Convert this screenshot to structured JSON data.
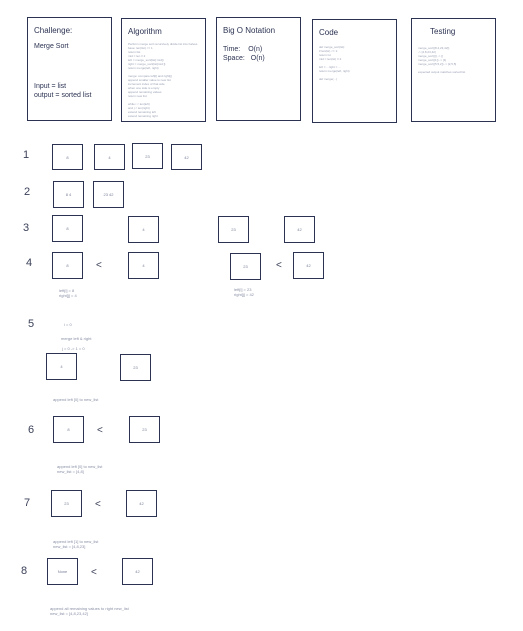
{
  "cards": [
    {
      "title": "Challenge:",
      "line1": "Merge Sort",
      "line2": "Input = list",
      "line3": "output = sorted list"
    },
    {
      "title": "Algorithm",
      "lines": [
        "Perform merge sort recursively divide list into halves",
        "  base: len(list) <= 1",
        "  return list",
        "  mid = len // 2",
        "  left = merge_sort(list[:mid])",
        "  right = merge_sort(list[mid:])",
        "  return merge(left, right)",
        "",
        "merge: compare left[i] and right[j]",
        "  append smaller value to new list",
        "  increment index of that side",
        "  when one side is empty",
        "    append remaining values",
        "  return new list",
        "",
        "  while i < len(left)",
        "    and j < len(right)",
        "  extend remaining left",
        "  extend remaining right"
      ]
    },
    {
      "title": "Big O Notation",
      "time_label": "Time:",
      "time_value": "O(n)",
      "space_label": "Space:",
      "space_value": "O(n)"
    },
    {
      "title": "Code",
      "lines": [
        "def merge_sort(lst):",
        "  if len(lst) <= 1:",
        "    return lst",
        "  mid = len(lst) // 2",
        "",
        "  left = ...right = ...",
        "  return merge(left, right)",
        "",
        "def merge(...)"
      ]
    },
    {
      "title": "Testing",
      "lines": [
        "merge_sort([8,4,23,42])",
        "  -> [4,8,23,42]",
        "merge_sort([]) -> []",
        "merge_sort([1]) -> [1]",
        "merge_sort([5,5,2]) -> [2,5,5]",
        "",
        "expected output matches sorted list"
      ]
    }
  ],
  "steps": [
    "1",
    "2",
    "3",
    "4",
    "5",
    "6",
    "7",
    "8"
  ],
  "row1": [
    "8",
    "4",
    "23",
    "42"
  ],
  "row2": [
    "8 4",
    "23 42"
  ],
  "row3": [
    "8",
    "4",
    "23",
    "42"
  ],
  "row4": [
    "8",
    "4",
    "23",
    "42"
  ],
  "row4_notes": {
    "left": "left[i] = 8\nright[j] = 4",
    "right": "left[i] = 23\nright[j] = 42"
  },
  "lt": "<",
  "row5_notes": {
    "a": "i = 0",
    "b": "merge left & right",
    "c": "j = 0 -> 1 = 0"
  },
  "row5": [
    "4",
    "23"
  ],
  "row5_caption": "append left [0] to new_list",
  "row6": [
    "8",
    "23"
  ],
  "row6_caption": "append left [0] to new_list\nnew_list = [4,8]",
  "row7": [
    "23",
    "42"
  ],
  "row7_caption": "append left [1] to new_list\nnew_list = [4,8,23]",
  "row8": [
    "None",
    "42"
  ],
  "row8_caption": "append all remaining values to right new_list\nnew_list = [4,8,23,42]"
}
